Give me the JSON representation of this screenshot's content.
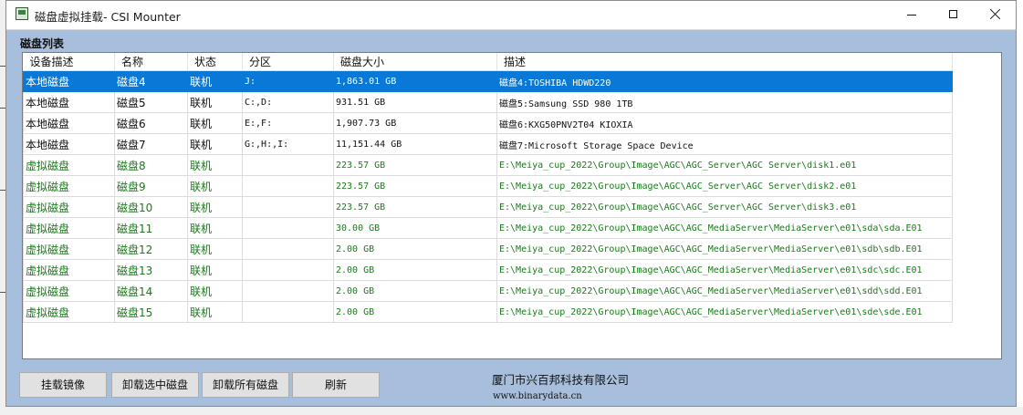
{
  "window": {
    "title": "磁盘虚拟挂载- CSI Mounter"
  },
  "disk_list": {
    "group_label": "磁盘列表",
    "columns": [
      "设备描述",
      "名称",
      "状态",
      "分区",
      "磁盘大小",
      "描述"
    ],
    "rows": [
      [
        "本地磁盘",
        "磁盘4",
        "联机",
        "J:",
        "1,863.01 GB",
        "磁盘4:TOSHIBA HDWD220"
      ],
      [
        "本地磁盘",
        "磁盘5",
        "联机",
        "C:,D:",
        "931.51 GB",
        "磁盘5:Samsung SSD 980 1TB"
      ],
      [
        "本地磁盘",
        "磁盘6",
        "联机",
        "E:,F:",
        "1,907.73 GB",
        "磁盘6:KXG50PNV2T04 KIOXIA"
      ],
      [
        "本地磁盘",
        "磁盘7",
        "联机",
        "G:,H:,I:",
        "11,151.44 GB",
        "磁盘7:Microsoft Storage Space Device"
      ],
      [
        "虚拟磁盘",
        "磁盘8",
        "联机",
        "",
        "223.57 GB",
        "E:\\Meiya_cup_2022\\Group\\Image\\AGC\\AGC_Server\\AGC Server\\disk1.e01"
      ],
      [
        "虚拟磁盘",
        "磁盘9",
        "联机",
        "",
        "223.57 GB",
        "E:\\Meiya_cup_2022\\Group\\Image\\AGC\\AGC_Server\\AGC Server\\disk2.e01"
      ],
      [
        "虚拟磁盘",
        "磁盘10",
        "联机",
        "",
        "223.57 GB",
        "E:\\Meiya_cup_2022\\Group\\Image\\AGC\\AGC_Server\\AGC Server\\disk3.e01"
      ],
      [
        "虚拟磁盘",
        "磁盘11",
        "联机",
        "",
        "30.00 GB",
        "E:\\Meiya_cup_2022\\Group\\Image\\AGC\\AGC_MediaServer\\MediaServer\\e01\\sda\\sda.E01"
      ],
      [
        "虚拟磁盘",
        "磁盘12",
        "联机",
        "",
        "2.00 GB",
        "E:\\Meiya_cup_2022\\Group\\Image\\AGC\\AGC_MediaServer\\MediaServer\\e01\\sdb\\sdb.E01"
      ],
      [
        "虚拟磁盘",
        "磁盘13",
        "联机",
        "",
        "2.00 GB",
        "E:\\Meiya_cup_2022\\Group\\Image\\AGC\\AGC_MediaServer\\MediaServer\\e01\\sdc\\sdc.E01"
      ],
      [
        "虚拟磁盘",
        "磁盘14",
        "联机",
        "",
        "2.00 GB",
        "E:\\Meiya_cup_2022\\Group\\Image\\AGC\\AGC_MediaServer\\MediaServer\\e01\\sdd\\sdd.E01"
      ],
      [
        "虚拟磁盘",
        "磁盘15",
        "联机",
        "",
        "2.00 GB",
        "E:\\Meiya_cup_2022\\Group\\Image\\AGC\\AGC_MediaServer\\MediaServer\\e01\\sde\\sde.E01"
      ]
    ],
    "selected_row": 0
  },
  "buttons": {
    "mount_image": "挂载镜像",
    "unmount_selected": "卸载选中磁盘",
    "unmount_all": "卸载所有磁盘",
    "refresh": "刷新"
  },
  "footer": {
    "company": "厦门市兴百邦科技有限公司",
    "website": "www.binarydata.cn"
  },
  "colors": {
    "window_bg": "#a7bfdc",
    "selected_row_bg": "#0a78d7",
    "virtual_disk_text": "#1b7a1b",
    "local_disk_text": "#111111"
  },
  "icons": {
    "app": "app-icon",
    "minimize": "minimize-icon",
    "maximize": "maximize-icon",
    "close": "close-icon"
  }
}
